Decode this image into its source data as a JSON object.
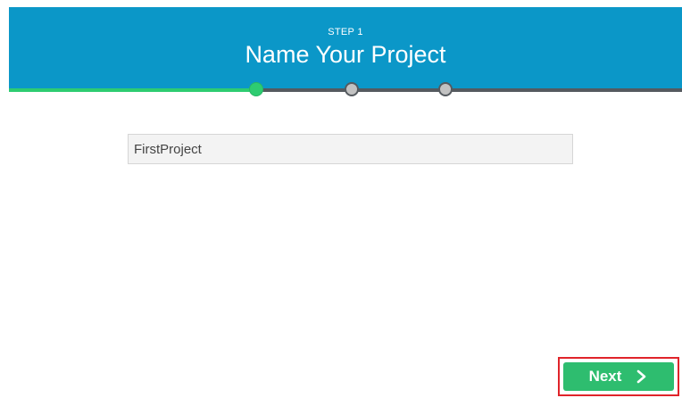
{
  "wizard": {
    "step_label": "STEP 1",
    "title": "Name Your Project",
    "steps_total": 3,
    "current_step": 1,
    "colors": {
      "header": "#0b97c8",
      "complete": "#2ecc71",
      "track": "#555a5f",
      "pending_dot": "#c2c2c2",
      "highlight_border": "#e0242a"
    }
  },
  "project_name": {
    "value": "FirstProject",
    "placeholder": ""
  },
  "footer": {
    "next_label": "Next",
    "next_icon": "chevron-right-icon"
  }
}
